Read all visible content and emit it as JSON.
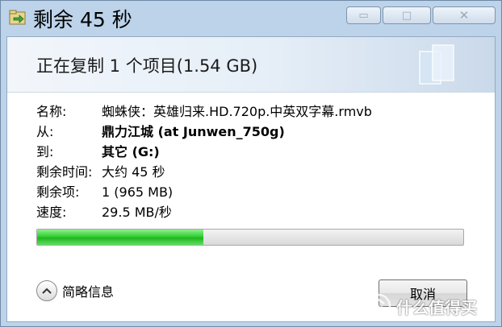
{
  "window": {
    "title": "剩余 45 秒"
  },
  "controls": {
    "minimize": "▭",
    "maximize": "□",
    "close": "✕"
  },
  "banner": {
    "heading": "正在复制 1 个项目(1.54 GB)"
  },
  "info": [
    {
      "label": "名称:",
      "value": "蜘蛛侠：英雄归来.HD.720p.中英双字幕.rmvb",
      "bold": false
    },
    {
      "label": "从:",
      "value": "鼎力江城 (at Junwen_750g)",
      "bold": true
    },
    {
      "label": "到:",
      "value": "其它 (G:)",
      "bold": true
    },
    {
      "label": "剩余时间:",
      "value": "大约 45 秒",
      "bold": false
    },
    {
      "label": "剩余项:",
      "value": "1 (965 MB)",
      "bold": false
    },
    {
      "label": "速度:",
      "value": "29.5 MB/秒",
      "bold": false
    }
  ],
  "progress": {
    "fraction": 0.39,
    "color": "#34d034"
  },
  "footer": {
    "details_label": "简略信息",
    "cancel_label": "取消"
  },
  "watermark": {
    "text": "什么值得买"
  }
}
